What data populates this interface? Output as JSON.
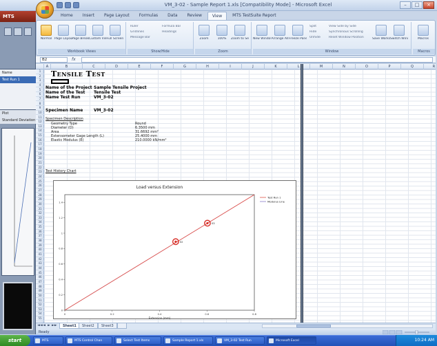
{
  "window": {
    "title": "VM_3-02 - Sample Report 1.xls [Compatibility Mode] - Microsoft Excel",
    "controls": [
      "–",
      "□",
      "×"
    ]
  },
  "left_panel": {
    "header": "MTS",
    "tree": [
      "Name",
      "Test Run 1"
    ],
    "tree2": [
      "Plot",
      "Standard Deviation"
    ]
  },
  "ribbon": {
    "tabs": [
      "Home",
      "Insert",
      "Page Layout",
      "Formulas",
      "Data",
      "Review",
      "View",
      "MTS TestSuite Report"
    ],
    "active_tab": "View",
    "groups": [
      {
        "label": "Workbook Views",
        "buttons": [
          "Normal",
          "Page Layout",
          "Page Break Preview",
          "Custom Views",
          "Full Screen"
        ]
      },
      {
        "label": "Show/Hide",
        "buttons": [
          "Ruler",
          "Gridlines",
          "Message Bar",
          "Formula Bar",
          "Headings"
        ]
      },
      {
        "label": "Zoom",
        "buttons": [
          "Zoom",
          "100%",
          "Zoom to Selection"
        ]
      },
      {
        "label": "Window",
        "buttons": [
          "New Window",
          "Arrange All",
          "Freeze Panes",
          "Split",
          "Hide",
          "Unhide",
          "View Side by Side",
          "Synchronous Scrolling",
          "Reset Window Position",
          "Save Workspace",
          "Switch Windows"
        ]
      },
      {
        "label": "Macros",
        "buttons": [
          "Macros"
        ]
      }
    ]
  },
  "formula_bar": {
    "name_box": "B2",
    "fx": "fx",
    "value": ""
  },
  "grid": {
    "columns": [
      "A",
      "B",
      "C",
      "D",
      "E",
      "F",
      "G",
      "H",
      "I",
      "J",
      "K",
      "L",
      "M",
      "N",
      "O",
      "P",
      "Q",
      "R",
      "S"
    ],
    "row_count": 55
  },
  "sheet": {
    "title": "Tensile Test",
    "project_label": "Name of the Project",
    "project_value": "Sample Tensile Project",
    "test_label": "Name of the Test",
    "test_value": "Tensile Test",
    "run_label": "Name Test Run",
    "run_value": "VM_3-02",
    "specimen_label": "Specimen Name",
    "specimen_value": "VM_3-02",
    "specimen_section": "Specimen Description",
    "specimen_rows": [
      {
        "label": "Geometry Type",
        "value": "Round"
      },
      {
        "label": "Diameter (D)",
        "value": "6.3500 mm"
      },
      {
        "label": "Area",
        "value": "31.6692 mm²"
      },
      {
        "label": "Extensometer Gage Length (L)",
        "value": "25.4000 mm"
      },
      {
        "label": "Elastic Modulus (E)",
        "value": "210.0000 kN/mm²"
      }
    ],
    "chart_section": "Test History Chart"
  },
  "chart_data": {
    "type": "line",
    "title": "Load versus Extension",
    "xlabel": "Extension (mm)",
    "ylabel": "",
    "xlim": [
      0,
      0.8
    ],
    "ylim": [
      0,
      1.5
    ],
    "x_ticks": [
      "0",
      "0.2",
      "0.4",
      "0.6",
      "0.8"
    ],
    "y_ticks": [
      "0",
      "0.2",
      "0.4",
      "0.6",
      "0.8",
      "1",
      "1.2",
      "1.4"
    ],
    "series": [
      {
        "name": "Test Run 1",
        "color": "#e0524a",
        "x": [
          0,
          0.8
        ],
        "y": [
          0,
          1.5
        ]
      },
      {
        "name": "Modulus Line",
        "color": "#8a7cc9",
        "x": [
          0,
          0.8
        ],
        "y": [
          0,
          1.5
        ]
      }
    ],
    "markers": [
      {
        "label": "02",
        "x": 0.468,
        "y": 0.89
      },
      {
        "label": "03",
        "x": 0.602,
        "y": 1.13
      }
    ],
    "legend": "top-right",
    "grid": false
  },
  "sheet_tabs": {
    "nav": [
      "◄◄",
      "◄",
      "►",
      "►►"
    ],
    "tabs": [
      "Sheet1",
      "Sheet2",
      "Sheet3"
    ],
    "active": "Sheet1"
  },
  "status": {
    "text": "Ready"
  },
  "taskbar": {
    "start": "start",
    "items": [
      "MTS",
      "MTS Control Chan",
      "Select Test Items",
      "Sample Report 1.xls",
      "VM_3-02 Test Run",
      "Microsoft Excel"
    ],
    "clock": "10:24 AM"
  }
}
